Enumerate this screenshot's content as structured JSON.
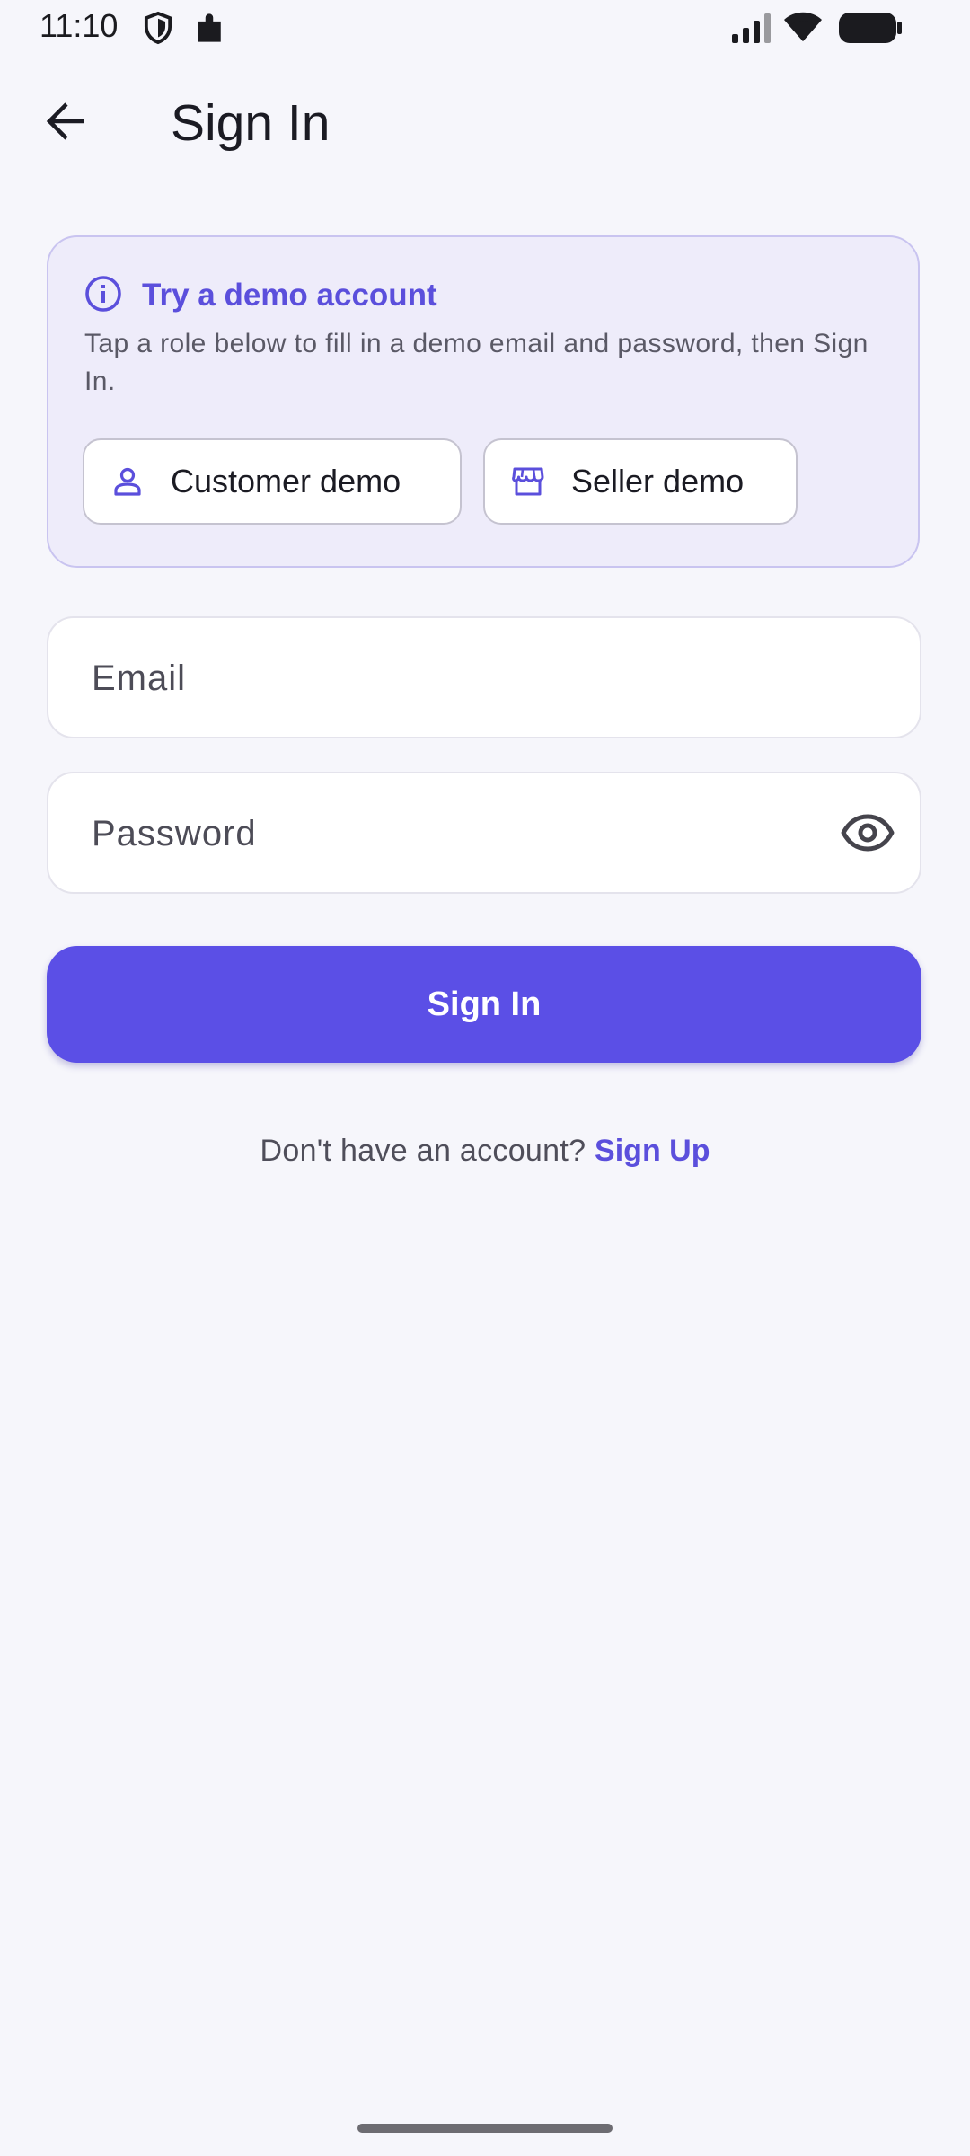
{
  "status_bar": {
    "time": "11:10",
    "icons": [
      "shield-icon",
      "puzzle-icon",
      "signal-icon",
      "wifi-icon",
      "battery-icon"
    ]
  },
  "app_bar": {
    "back_icon": "arrow-back-icon",
    "title": "Sign In"
  },
  "demo_card": {
    "icon": "info-icon",
    "title": "Try a demo account",
    "description": "Tap a role below to fill in a demo email and password, then Sign In.",
    "buttons": [
      {
        "label": "Customer demo",
        "icon": "person-icon"
      },
      {
        "label": "Seller demo",
        "icon": "storefront-icon"
      }
    ]
  },
  "form": {
    "email": {
      "value": "",
      "placeholder": "Email"
    },
    "password": {
      "value": "",
      "placeholder": "Password",
      "toggle_icon": "eye-icon"
    },
    "submit_label": "Sign In"
  },
  "signup": {
    "prompt": "Don't have an account? ",
    "link": "Sign Up"
  },
  "colors": {
    "accent": "#5b4fe6",
    "link": "#5b4fdc",
    "background": "#f6f6fb",
    "card_background": "#eeecfa"
  }
}
